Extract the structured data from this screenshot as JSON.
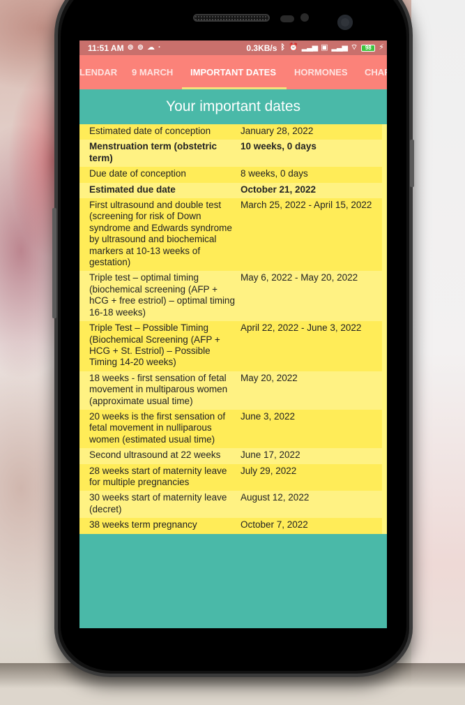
{
  "status_bar": {
    "time": "11:51 AM",
    "left_icons": [
      "at-sign-icon",
      "at-sign-icon",
      "cloud-icon",
      "dot-icon"
    ],
    "network_speed": "0.3KB/s",
    "right_icons": [
      "bluetooth-icon",
      "alarm-icon",
      "signal-icon",
      "volte-icon",
      "signal-icon",
      "wifi-icon"
    ],
    "battery_level": "98",
    "charging_icon": "bolt-icon"
  },
  "tabs": [
    {
      "label": "LENDAR",
      "active": false
    },
    {
      "label": "9 MARCH",
      "active": false
    },
    {
      "label": "IMPORTANT DATES",
      "active": true
    },
    {
      "label": "HORMONES",
      "active": false
    },
    {
      "label": "CHAR",
      "active": false
    }
  ],
  "page": {
    "title": "Your important dates"
  },
  "dates": [
    {
      "label": "Estimated date of conception",
      "value": "January 28, 2022",
      "bold": false
    },
    {
      "label": "Menstruation term (obstetric term)",
      "value": "10 weeks, 0 days",
      "bold": true
    },
    {
      "label": "Due date of conception",
      "value": "8 weeks, 0 days",
      "bold": false
    },
    {
      "label": "Estimated due date",
      "value": "October 21, 2022",
      "bold": true
    },
    {
      "label": "First ultrasound and double test (screening for risk of Down syndrome and Edwards syndrome by ultrasound and biochemical markers at 10-13 weeks of gestation)",
      "value": "March 25, 2022 - April 15, 2022",
      "bold": false
    },
    {
      "label": "Triple test – optimal timing (biochemical screening (AFP + hCG + free estriol) – optimal timing 16-18 weeks)",
      "value": "May 6, 2022 - May 20, 2022",
      "bold": false
    },
    {
      "label": "Triple Test – Possible Timing (Biochemical Screening (AFP + HCG + St. Estriol) – Possible Timing 14-20 weeks)",
      "value": "April 22, 2022 - June 3, 2022",
      "bold": false
    },
    {
      "label": "18 weeks - first sensation of fetal movement in multiparous women (approximate usual time)",
      "value": "May 20, 2022",
      "bold": false
    },
    {
      "label": "20 weeks is the first sensation of fetal movement in nulliparous women (estimated usual time)",
      "value": "June 3, 2022",
      "bold": false
    },
    {
      "label": "Second ultrasound at 22 weeks",
      "value": "June 17, 2022",
      "bold": false
    },
    {
      "label": "28 weeks start of maternity leave for multiple pregnancies",
      "value": "July 29, 2022",
      "bold": false
    },
    {
      "label": "30 weeks start of maternity leave (decret)",
      "value": "August 12, 2022",
      "bold": false
    },
    {
      "label": "38 weeks term pregnancy",
      "value": "October 7, 2022",
      "bold": false
    }
  ],
  "colors": {
    "status_bar": "#c9706c",
    "tab_bar": "#fb8279",
    "tab_indicator": "#f4e27a",
    "header": "#4ab9a8",
    "row_dark": "#ffec58",
    "row_light": "#fff283"
  }
}
